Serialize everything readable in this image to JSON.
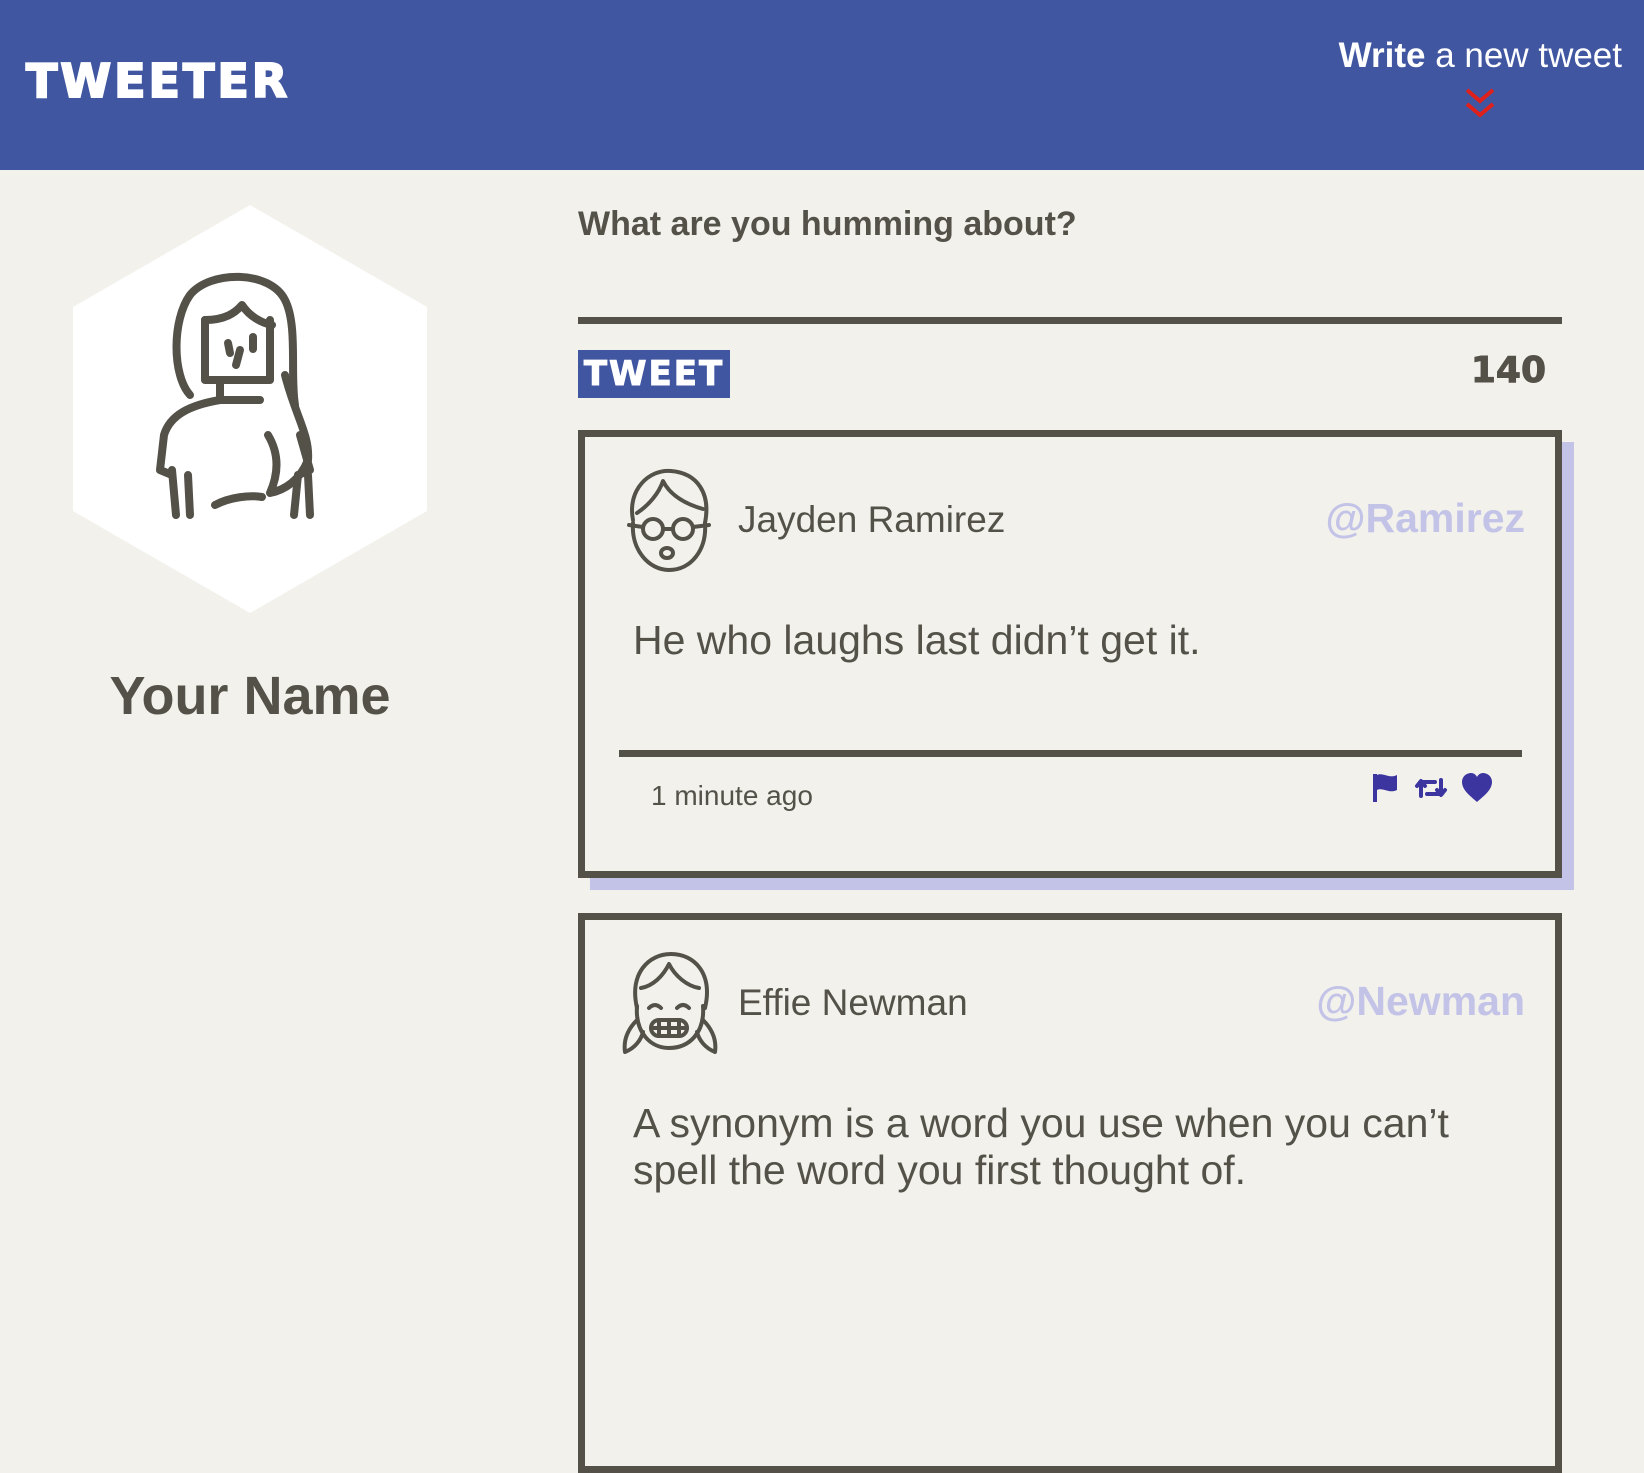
{
  "nav": {
    "logo": "TWEETER",
    "compose_bold": "Write",
    "compose_rest": " a new tweet"
  },
  "profile": {
    "name": "Your Name"
  },
  "new_tweet": {
    "label": "What are you humming about?",
    "input_value": "",
    "button": "TWEET",
    "counter": "140"
  },
  "tweets": [
    {
      "name": "Jayden Ramirez",
      "handle": "@Ramirez",
      "text": "He who laughs last didn’t get it.",
      "time": "1 minute ago",
      "avatar_icon": "boy-glasses-avatar-icon"
    },
    {
      "name": "Effie Newman",
      "handle": "@Newman",
      "text": "A synonym is a word you use when you can’t spell the word you first thought of.",
      "time": "",
      "avatar_icon": "girl-pigtails-avatar-icon"
    }
  ],
  "colors": {
    "nav_bg": "#4056a1",
    "page_bg": "#f2f1ec",
    "text": "#545149",
    "accent_light": "#c3c3e8",
    "arrow": "#e0201a",
    "action_icons": "#3c35a0"
  }
}
